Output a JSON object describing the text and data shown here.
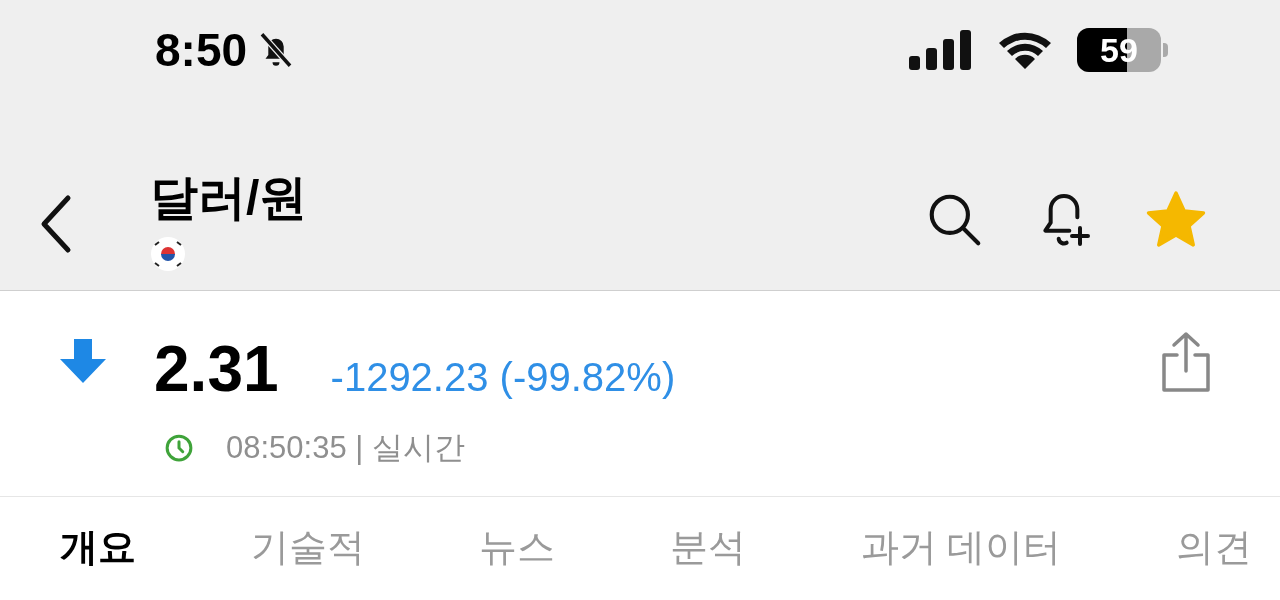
{
  "status_bar": {
    "time": "8:50",
    "silent": true,
    "battery": "59"
  },
  "header": {
    "title": "달러/원",
    "favorite": true
  },
  "quote": {
    "falling": true,
    "price": "2.31",
    "change": "-1292.23 (-99.82%)",
    "time": "08:50:35 | 실시간"
  },
  "tabs": [
    {
      "label": "개요",
      "selected": true
    },
    {
      "label": "기술적",
      "selected": false
    },
    {
      "label": "뉴스",
      "selected": false
    },
    {
      "label": "분석",
      "selected": false
    },
    {
      "label": "과거 데이터",
      "selected": false
    },
    {
      "label": "의견",
      "selected": false
    }
  ]
}
